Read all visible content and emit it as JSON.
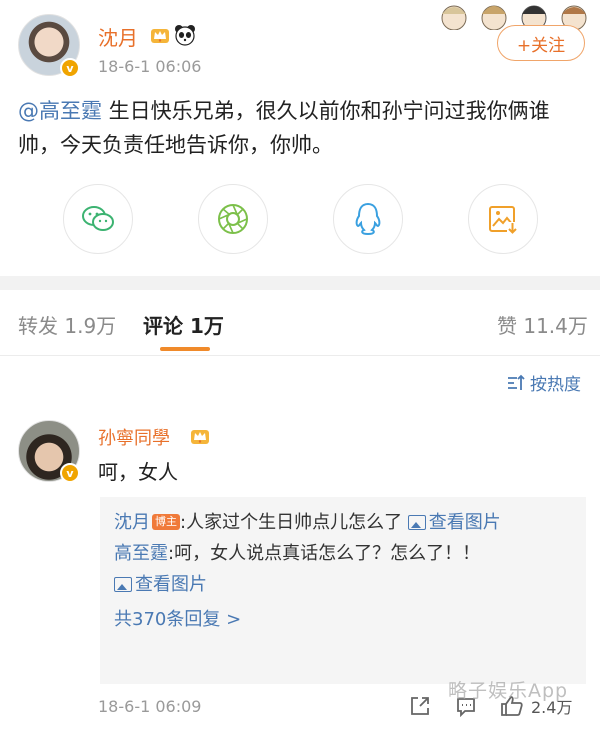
{
  "post": {
    "author": "沈月",
    "time": "18-6-1 06:06",
    "follow_label": "+关注",
    "mention": "@高至霆",
    "text": " 生日快乐兄弟，很久以前你和孙宁问过我你俩谁帅，今天负责任地告诉你，你帅。",
    "verified_icon": "v",
    "author_badges": [
      "crown-icon",
      "panda-icon"
    ]
  },
  "share": {
    "items": [
      {
        "name": "wechat-icon",
        "color": "#3cb371"
      },
      {
        "name": "moments-icon",
        "color": "#7cc04a"
      },
      {
        "name": "qq-icon",
        "color": "#3aa0e0"
      },
      {
        "name": "save-image-icon",
        "color": "#f0a02a"
      }
    ]
  },
  "tabs": {
    "repost": "转发 1.9万",
    "comments": "评论 1万",
    "likes": "赞 11.4万",
    "active_color": "#f08a2a"
  },
  "sort": {
    "label": "按热度"
  },
  "comment": {
    "author": "孙寧同學",
    "text": "呵，女人",
    "time": "18-6-1 06:09",
    "likes": "2.4万",
    "replies": [
      {
        "author": "沈月",
        "badge": "博主",
        "text": ":人家过个生日帅点儿怎么了 ",
        "link": "查看图片"
      },
      {
        "author": "高至霆",
        "text": ":呵，女人说点真话怎么了？怎么了！！",
        "link": "查看图片"
      }
    ],
    "reply_count": "共370条回复 >"
  },
  "watermark": "略子娱乐App",
  "colors": {
    "accent": "#e8702a",
    "link": "#4a79b3",
    "muted": "#9a9a9a"
  }
}
